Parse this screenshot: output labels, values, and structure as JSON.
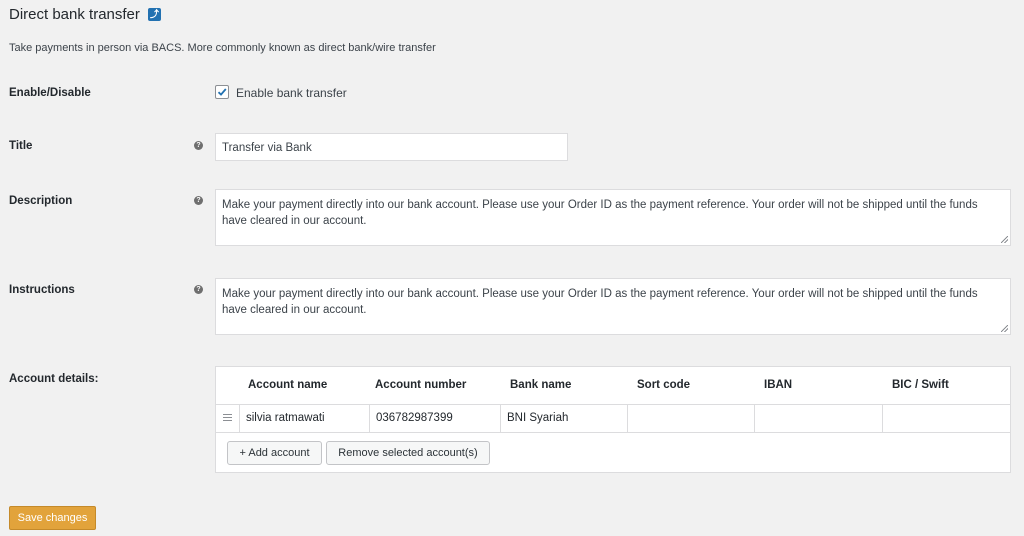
{
  "header": {
    "title": "Direct bank transfer",
    "back_icon": "back-arrow-icon"
  },
  "subtitle": "Take payments in person via BACS. More commonly known as direct bank/wire transfer",
  "enable": {
    "label": "Enable/Disable",
    "checkbox_label": "Enable bank transfer",
    "checked": true
  },
  "title_field": {
    "label": "Title",
    "value": "Transfer via Bank"
  },
  "description_field": {
    "label": "Description",
    "value": "Make your payment directly into our bank account. Please use your Order ID as the payment reference. Your order will not be shipped until the funds have cleared in our account."
  },
  "instructions_field": {
    "label": "Instructions",
    "value": "Make your payment directly into our bank account. Please use your Order ID as the payment reference. Your order will not be shipped until the funds have cleared in our account."
  },
  "accounts": {
    "label": "Account details:",
    "columns": [
      "Account name",
      "Account number",
      "Bank name",
      "Sort code",
      "IBAN",
      "BIC / Swift"
    ],
    "rows": [
      {
        "account_name": "silvia ratmawati",
        "account_number": "036782987399",
        "bank_name": "BNI Syariah",
        "sort_code": "",
        "iban": "",
        "bic": ""
      }
    ],
    "add_button": "+ Add account",
    "remove_button": "Remove selected account(s)"
  },
  "save_button": "Save changes",
  "colors": {
    "accent": "#2271b1",
    "save": "#e2a33b",
    "background": "#f1f1f1"
  }
}
